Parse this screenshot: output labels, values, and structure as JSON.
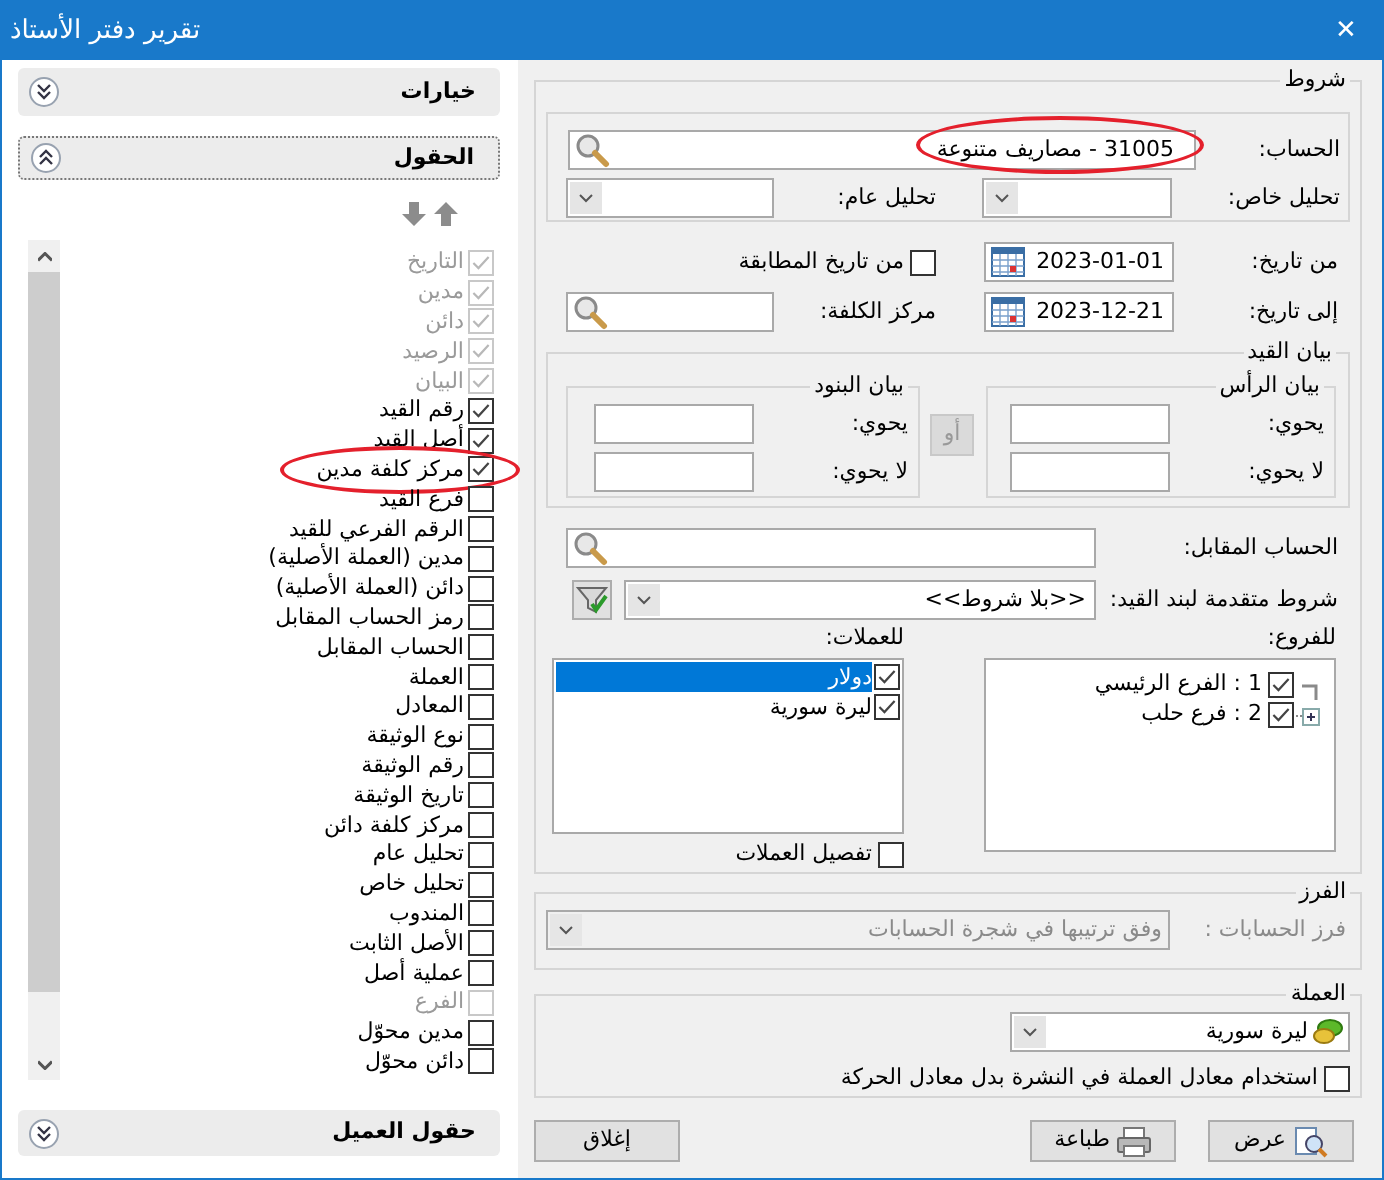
{
  "window": {
    "title": "تقرير دفتر الأستاذ",
    "close": "✕"
  },
  "sidebar": {
    "options_section": {
      "title": "خيارات",
      "expanded": false,
      "focused": false
    },
    "fields_section": {
      "title": "الحقول",
      "expanded": true,
      "focused": true,
      "fields": [
        {
          "label": "التاريخ",
          "checked": true,
          "disabled": true,
          "highlighted": false
        },
        {
          "label": "مدين",
          "checked": true,
          "disabled": true,
          "highlighted": false
        },
        {
          "label": "دائن",
          "checked": true,
          "disabled": true,
          "highlighted": false
        },
        {
          "label": "الرصيد",
          "checked": true,
          "disabled": true,
          "highlighted": false
        },
        {
          "label": "البيان",
          "checked": true,
          "disabled": true,
          "highlighted": false
        },
        {
          "label": "رقم القيد",
          "checked": true,
          "disabled": false,
          "highlighted": false
        },
        {
          "label": "أصل القيد",
          "checked": true,
          "disabled": false,
          "highlighted": false
        },
        {
          "label": "مركز كلفة مدين",
          "checked": true,
          "disabled": false,
          "highlighted": true
        },
        {
          "label": "فرع القيد",
          "checked": false,
          "disabled": false,
          "highlighted": false
        },
        {
          "label": "الرقم الفرعي للقيد",
          "checked": false,
          "disabled": false,
          "highlighted": false
        },
        {
          "label": "مدين (العملة الأصلية)",
          "checked": false,
          "disabled": false,
          "highlighted": false
        },
        {
          "label": "دائن (العملة الأصلية)",
          "checked": false,
          "disabled": false,
          "highlighted": false
        },
        {
          "label": "رمز الحساب المقابل",
          "checked": false,
          "disabled": false,
          "highlighted": false
        },
        {
          "label": "الحساب المقابل",
          "checked": false,
          "disabled": false,
          "highlighted": false
        },
        {
          "label": "العملة",
          "checked": false,
          "disabled": false,
          "highlighted": false
        },
        {
          "label": "المعادل",
          "checked": false,
          "disabled": false,
          "highlighted": false
        },
        {
          "label": "نوع الوثيقة",
          "checked": false,
          "disabled": false,
          "highlighted": false
        },
        {
          "label": "رقم الوثيقة",
          "checked": false,
          "disabled": false,
          "highlighted": false
        },
        {
          "label": "تاريخ الوثيقة",
          "checked": false,
          "disabled": false,
          "highlighted": false
        },
        {
          "label": "مركز كلفة دائن",
          "checked": false,
          "disabled": false,
          "highlighted": false
        },
        {
          "label": "تحليل عام",
          "checked": false,
          "disabled": false,
          "highlighted": false
        },
        {
          "label": "تحليل خاص",
          "checked": false,
          "disabled": false,
          "highlighted": false
        },
        {
          "label": "المندوب",
          "checked": false,
          "disabled": false,
          "highlighted": false
        },
        {
          "label": "الأصل الثابت",
          "checked": false,
          "disabled": false,
          "highlighted": false
        },
        {
          "label": "عملية أصل",
          "checked": false,
          "disabled": false,
          "highlighted": false
        },
        {
          "label": "الفرع",
          "checked": false,
          "disabled": true,
          "highlighted": false
        },
        {
          "label": "مدين محوّل",
          "checked": false,
          "disabled": false,
          "highlighted": false
        },
        {
          "label": "دائن محوّل",
          "checked": false,
          "disabled": false,
          "highlighted": false
        }
      ]
    },
    "customer_fields_section": {
      "title": "حقول العميل",
      "expanded": false,
      "focused": false
    }
  },
  "conditions": {
    "title": "شروط",
    "account": {
      "label": "الحساب:",
      "value": "31005 - مصاريف متنوعة",
      "highlighted": true
    },
    "special_analysis": {
      "label": "تحليل خاص:"
    },
    "general_analysis": {
      "label": "تحليل عام:"
    },
    "from_date": {
      "label": "من تاريخ:",
      "value": "2023-01-01"
    },
    "from_matching_date": {
      "label": "من تاريخ المطابقة",
      "checked": false
    },
    "to_date": {
      "label": "إلى تاريخ:",
      "value": "2023-12-21"
    },
    "cost_center": {
      "label": "مركز الكلفة:"
    },
    "entry_statement": {
      "title": "بيان القيد",
      "header": {
        "title": "بيان الرأس",
        "contains_label": "يحوي:",
        "not_contains_label": "لا يحوي:"
      },
      "or_button": {
        "label": "أو",
        "disabled": true
      },
      "lines": {
        "title": "بيان البنود",
        "contains_label": "يحوي:",
        "not_contains_label": "لا يحوي:"
      }
    },
    "contra_account": {
      "label": "الحساب المقابل:"
    },
    "advanced_conditions": {
      "label": "شروط متقدمة لبند القيد:",
      "value": "<<بلا شروط>>"
    },
    "branches": {
      "label": "للفروع:",
      "items": [
        {
          "label": "1 : الفرع الرئيسي",
          "checked": true,
          "expandable": false
        },
        {
          "label": "2 : فرع حلب",
          "checked": true,
          "expandable": true
        }
      ]
    },
    "currencies": {
      "label": "للعملات:",
      "items": [
        {
          "label": "دولار",
          "checked": true,
          "selected": true
        },
        {
          "label": "ليرة سورية",
          "checked": true,
          "selected": false
        }
      ]
    },
    "currency_details": {
      "label": "تفصيل العملات",
      "checked": false
    }
  },
  "sort": {
    "title": "الفرز",
    "label": "فرز الحسابات :",
    "value": "وفق ترتيبها في شجرة الحسابات",
    "disabled": true
  },
  "currency": {
    "title": "العملة",
    "value": "ليرة سورية",
    "use_bulletin_rate": {
      "label": "استخدام معادل العملة في النشرة بدل معادل الحركة",
      "checked": false
    }
  },
  "buttons": [
    {
      "label": "عرض",
      "kind": "preview"
    },
    {
      "label": "طباعة",
      "kind": "print"
    },
    {
      "label": "إغلاق",
      "kind": "plain"
    }
  ]
}
